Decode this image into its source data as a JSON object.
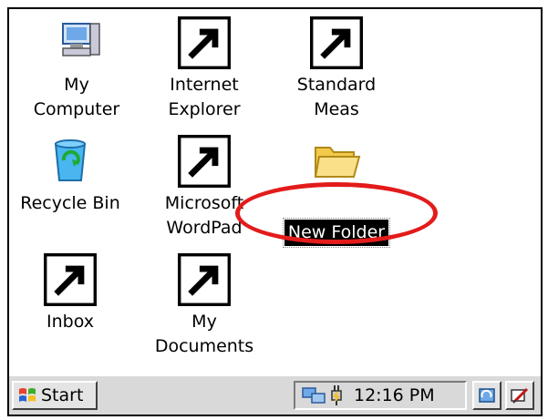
{
  "desktop": {
    "icons": [
      {
        "label": "My\nComputer",
        "icon": "my-computer-icon"
      },
      {
        "label": "Internet\nExplorer",
        "icon": "internet-explorer-icon"
      },
      {
        "label": "Standard\nMeas",
        "icon": "survey-instrument-icon"
      },
      {
        "label": "Recycle Bin",
        "icon": "recycle-bin-icon"
      },
      {
        "label": "Microsoft\nWordPad",
        "icon": "wordpad-icon"
      },
      {
        "label": "New Folder",
        "icon": "folder-icon",
        "state": "renaming"
      },
      {
        "label": "Inbox",
        "icon": "inbox-icon"
      },
      {
        "label": "My\nDocuments",
        "icon": "folder-icon"
      }
    ]
  },
  "taskbar": {
    "start_label": "Start",
    "clock": "12:16 PM",
    "tray_icons": [
      "network-icon",
      "power-plug-icon"
    ],
    "buttons": [
      "desktop-toggle-icon",
      "pen-input-icon"
    ]
  },
  "colors": {
    "highlight_ring": "#e31b1b",
    "selection": "#000000"
  }
}
